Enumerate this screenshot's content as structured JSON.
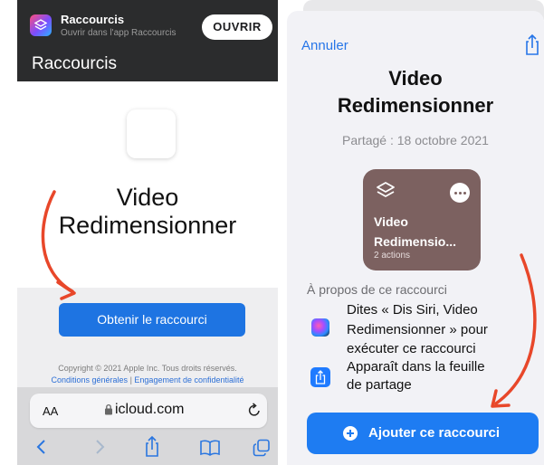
{
  "left": {
    "banner": {
      "app_name": "Raccourcis",
      "subtitle": "Ouvrir dans l'app Raccourcis",
      "open_label": "OUVRIR"
    },
    "nav_title": "Raccourcis",
    "shortcut_title_line1": "Video",
    "shortcut_title_line2": "Redimensionner",
    "get_button": "Obtenir le raccourci",
    "copyright": "Copyright © 2021 Apple Inc. Tous droits réservés.",
    "link_terms": "Conditions générales",
    "link_separator": "|",
    "link_privacy": "Engagement de confidentialité",
    "safari": {
      "aa_label": "AA",
      "url": "icloud.com"
    }
  },
  "right": {
    "cancel_label": "Annuler",
    "title_line1": "Video",
    "title_line2": "Redimensionner",
    "shared_date": "Partagé : 18 octobre 2021",
    "card": {
      "name_line1": "Video",
      "name_line2": "Redimensio...",
      "actions": "2 actions",
      "color": "#7c6160"
    },
    "about_heading": "À propos de ce raccourci",
    "siri_lines": [
      "Dites « Dis Siri, Video",
      "Redimensionner » pour",
      "exécuter ce raccourci"
    ],
    "share_lines": [
      "Apparaît dans la feuille",
      "de partage"
    ],
    "add_button": "Ajouter ce raccourci"
  },
  "colors": {
    "accent": "#1e7cf2",
    "annotation_arrow": "#e8472a",
    "highlight": "#ffe03a"
  }
}
